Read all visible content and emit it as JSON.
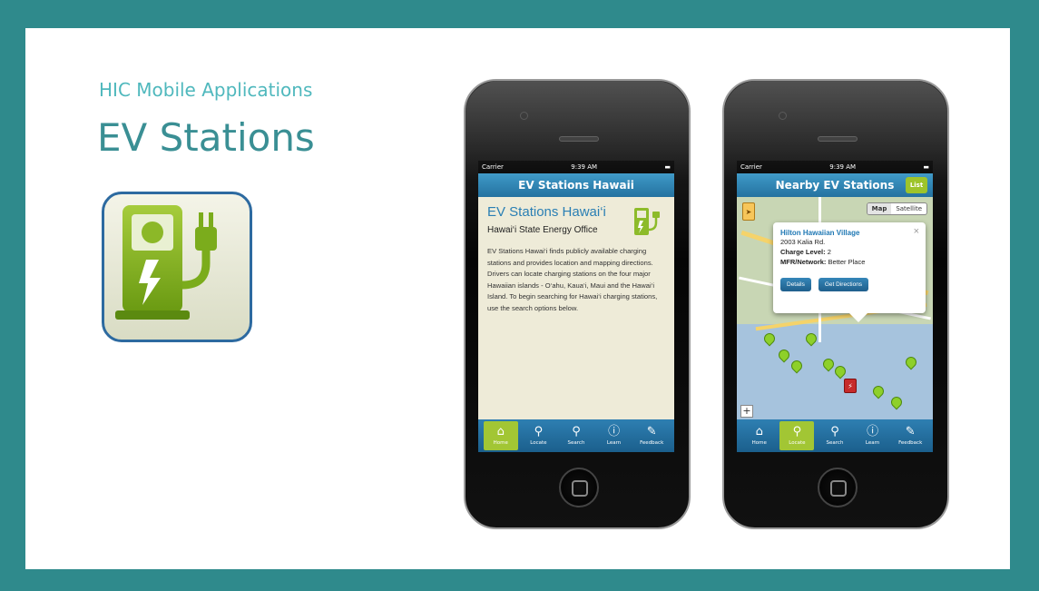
{
  "header": {
    "subtitle": "HIC Mobile Applications",
    "title": "EV Stations"
  },
  "phone1": {
    "status": {
      "carrier": "Carrier",
      "time": "9:39 AM"
    },
    "nav_title": "EV Stations Hawaii",
    "app_title": "EV Stations Hawai‘i",
    "org": "Hawai‘i State Energy Office",
    "description": "EV Stations Hawai‘i finds publicly available charging stations and provides location and mapping directions. Drivers can locate charging stations on the four major Hawaiian islands - O‘ahu, Kaua‘i, Maui and the Hawai‘i Island. To begin searching for Hawai‘i charging stations, use the search options below.",
    "tabs": [
      {
        "label": "Home",
        "icon": "home-icon"
      },
      {
        "label": "Locate",
        "icon": "pin-icon"
      },
      {
        "label": "Search",
        "icon": "search-icon"
      },
      {
        "label": "Learn",
        "icon": "info-icon"
      },
      {
        "label": "Feedback",
        "icon": "edit-icon"
      }
    ],
    "active_tab": "Home"
  },
  "phone2": {
    "status": {
      "carrier": "Carrier",
      "time": "9:39 AM"
    },
    "nav_title": "Nearby EV Stations",
    "list_button": "List",
    "map_toggle": {
      "map": "Map",
      "satellite": "Satellite",
      "selected": "Map"
    },
    "popup": {
      "name": "Hilton Hawaiian Village",
      "address": "2003 Kalia Rd.",
      "charge_label": "Charge Level:",
      "charge_value": "2",
      "network_label": "MFR/Network:",
      "network_value": "Better Place",
      "details_button": "Details",
      "directions_button": "Get Directions"
    },
    "tabs": [
      {
        "label": "Home",
        "icon": "home-icon"
      },
      {
        "label": "Locate",
        "icon": "pin-icon"
      },
      {
        "label": "Search",
        "icon": "search-icon"
      },
      {
        "label": "Learn",
        "icon": "info-icon"
      },
      {
        "label": "Feedback",
        "icon": "edit-icon"
      }
    ],
    "active_tab": "Locate"
  },
  "colors": {
    "frame": "#2f8a8c",
    "accent_teal": "#3a8f94",
    "nav_blue": "#2572a0",
    "active_green": "#a2c634"
  }
}
